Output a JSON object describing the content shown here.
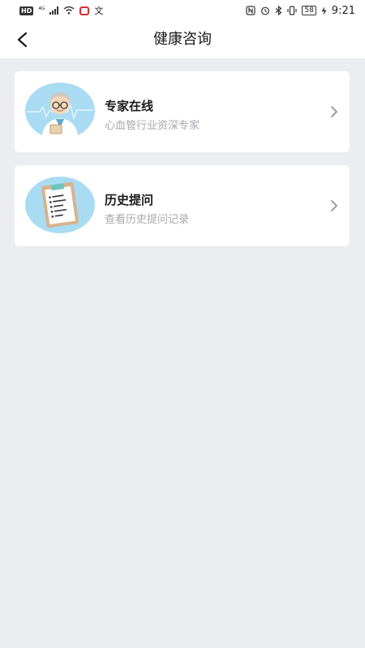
{
  "status_bar": {
    "hd": "HD",
    "network": "⁴ᴳ",
    "ime": "文",
    "battery": "58",
    "time": "9:21"
  },
  "header": {
    "title": "健康咨询"
  },
  "cards": [
    {
      "title": "专家在线",
      "subtitle": "心血管行业资深专家",
      "icon": "doctor-avatar"
    },
    {
      "title": "历史提问",
      "subtitle": "查看历史提问记录",
      "icon": "clipboard"
    }
  ],
  "colors": {
    "background": "#ECEDF1",
    "card": "#FFFFFF",
    "avatar_bg": "#A9DCF3",
    "subtitle": "#A8A8AE"
  }
}
